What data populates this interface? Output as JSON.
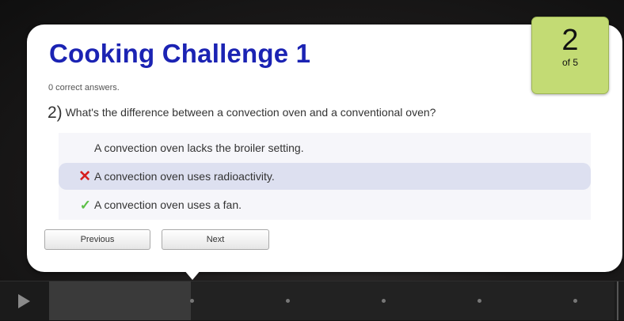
{
  "quiz": {
    "title": "Cooking Challenge 1",
    "score_text": "0 correct answers.",
    "question_number": "2)",
    "question_text": "What's the difference between a convection oven and a conventional oven?",
    "answers": [
      {
        "label": "A convection oven lacks the broiler setting.",
        "mark": "none",
        "selected": false
      },
      {
        "label": "A convection oven uses radioactivity.",
        "mark": "incorrect",
        "selected": true
      },
      {
        "label": "A convection oven uses a fan.",
        "mark": "correct",
        "selected": false
      }
    ],
    "counter": {
      "current": "2",
      "total_label": "of 5"
    },
    "buttons": {
      "previous": "Previous",
      "next": "Next"
    }
  },
  "icons": {
    "incorrect": "x-icon",
    "correct": "checkmark-icon",
    "play": "play-icon"
  },
  "colors": {
    "title": "#1b23b3",
    "counter_badge": "#c3db74",
    "selected_answer": "#dde0f0",
    "incorrect": "#d61e1e",
    "correct": "#5cbf46"
  },
  "player": {
    "progress": 0.25,
    "question_markers": 5
  }
}
